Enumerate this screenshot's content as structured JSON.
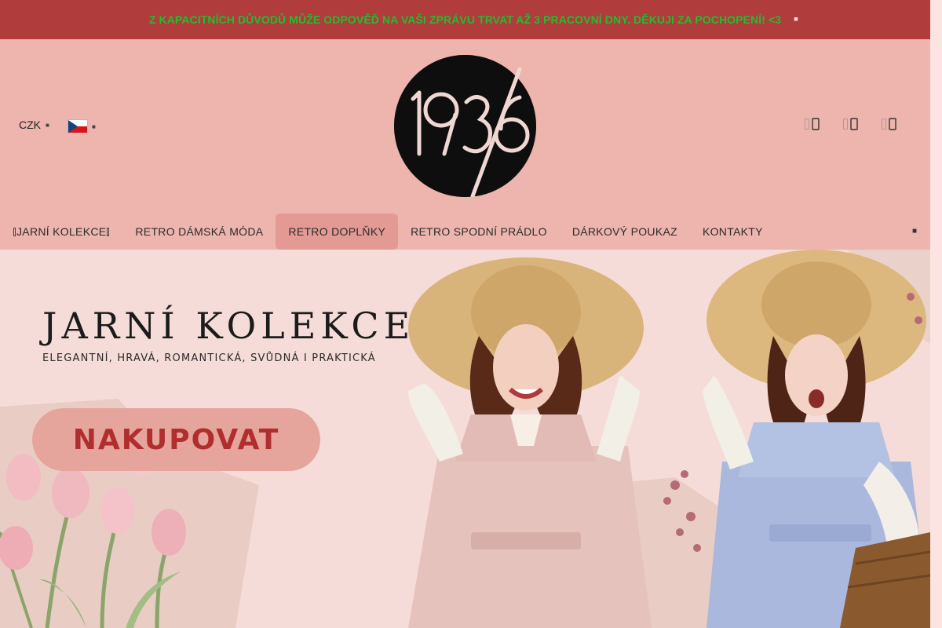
{
  "announcement": {
    "text": "Z KAPACITNÍCH DŮVODŮ MŮŽE ODPOVĚĎ NA VAŠI ZPRÁVU TRVAT AŽ 3 PRACOVNÍ DNY. DĚKUJI ZA POCHOPENÍ! <3",
    "close_icon": "close-icon"
  },
  "header": {
    "currency": "CZK",
    "language_flag": "czech-flag-icon",
    "logo_text": "1936",
    "icons": [
      "search-icon",
      "user-icon",
      "cart-icon"
    ]
  },
  "nav": {
    "items": [
      {
        "label": "JARNÍ KOLEKCE",
        "active": false
      },
      {
        "label": "RETRO DÁMSKÁ MÓDA",
        "active": false
      },
      {
        "label": "RETRO DOPLŇKY",
        "active": true
      },
      {
        "label": "RETRO SPODNÍ PRÁDLO",
        "active": false
      },
      {
        "label": "DÁRKOVÝ POUKAZ",
        "active": false
      },
      {
        "label": "KONTAKTY",
        "active": false
      }
    ]
  },
  "hero": {
    "title": "JARNÍ KOLEKCE",
    "subtitle": "ELEGANTNÍ, HRAVÁ, ROMANTICKÁ, SVŮDNÁ I PRAKTICKÁ",
    "cta": "NAKUPOVAT"
  },
  "colors": {
    "announcement_bg": "#b03c3c",
    "announcement_text": "#1fbf2f",
    "header_bg": "#edb5ae",
    "nav_active_bg": "#e39a94",
    "hero_bg": "#f6dcd8",
    "cta_bg": "#e5a49c",
    "cta_text": "#b02e2e"
  }
}
